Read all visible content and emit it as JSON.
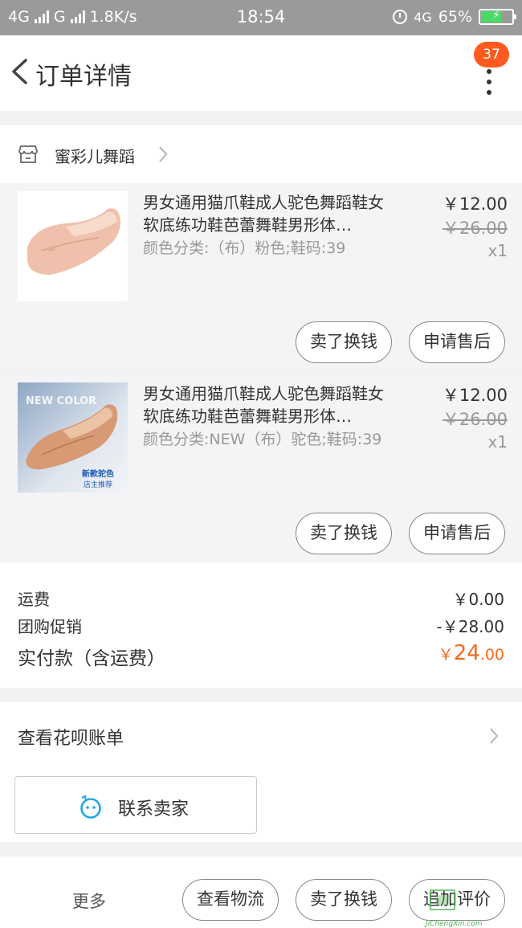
{
  "status_bar": {
    "network1": "4G",
    "network2": "G",
    "speed": "1.8K/s",
    "time": "18:54",
    "network3": "4G",
    "battery": "65%",
    "battery_level": 0.65,
    "colors": {
      "background": "#9a9a9a",
      "battery_fill": "#4cd964"
    }
  },
  "header": {
    "title": "订单详情",
    "badge_count": "37",
    "badge_color": "#ff5a1f"
  },
  "shop": {
    "name": "蜜彩儿舞蹈"
  },
  "items": [
    {
      "title": "男女通用猫爪鞋成人驼色舞蹈鞋女软底练功鞋芭蕾舞鞋男形体…",
      "spec": "颜色分类:（布）粉色;鞋码:39",
      "price": "￥12.00",
      "original_price": "￥26.00",
      "quantity": "x1",
      "sell_label": "卖了换钱",
      "after_sale_label": "申请售后"
    },
    {
      "title": "男女通用猫爪鞋成人驼色舞蹈鞋女软底练功鞋芭蕾舞鞋男形体…",
      "spec": "颜色分类:NEW（布）驼色;鞋码:39",
      "price": "￥12.00",
      "original_price": "￥26.00",
      "quantity": "x1",
      "sell_label": "卖了换钱",
      "after_sale_label": "申请售后",
      "image_text_top": "NEW COLOR",
      "image_text_main": "新款驼色",
      "image_text_sub": "店主推荐"
    }
  ],
  "summary": {
    "shipping_label": "运费",
    "shipping_value": "￥0.00",
    "promo_label": "团购促销",
    "promo_value": "-￥28.00",
    "paid_label": "实付款（含运费）",
    "paid_currency": "￥",
    "paid_int": "24",
    "paid_dec": ".00",
    "accent_color": "#f46b1e"
  },
  "huabei": {
    "label": "查看花呗账单"
  },
  "contact": {
    "label": "联系卖家"
  },
  "bottom_bar": {
    "more_label": "更多",
    "logistics_label": "查看物流",
    "sell_label": "卖了换钱",
    "review_label": "追加评价"
  },
  "watermark": {
    "text": "JiChengXin.com"
  }
}
